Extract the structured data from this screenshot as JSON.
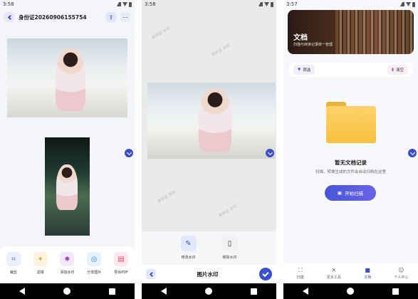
{
  "screen1": {
    "status_time": "3:58",
    "title": "身份证20260906155754",
    "tools": [
      {
        "label": "裁剪",
        "icon": "crop-icon",
        "color": "#5a6be0",
        "bg": "#eceffd"
      },
      {
        "label": "滤镜",
        "icon": "magic-wand-icon",
        "color": "#e7a52c",
        "bg": "#fdf3e1"
      },
      {
        "label": "添加水印",
        "icon": "watermark-icon",
        "color": "#9c47d8",
        "bg": "#f4e9fc"
      },
      {
        "label": "分享图片",
        "icon": "share-icon",
        "color": "#2f8fe0",
        "bg": "#e6f2fd"
      },
      {
        "label": "导出PDF",
        "icon": "pdf-icon",
        "color": "#e34b6a",
        "bg": "#fde8ee"
      }
    ]
  },
  "screen2": {
    "status_time": "3:58",
    "title": "图片水印",
    "tools": [
      {
        "label": "修改水印",
        "icon": "pen-icon"
      },
      {
        "label": "移除水印",
        "icon": "trash-icon"
      }
    ]
  },
  "screen3": {
    "status_time": "3:57",
    "banner_title": "文档",
    "banner_subtitle": "扫描与转换记录统一管理",
    "filter_label": "筛选",
    "clear_label": "清空",
    "empty_title": "暂无文档记录",
    "empty_subtitle": "扫描、转换生成的文件会自动归档在这里",
    "scan_button": "开始扫描",
    "tabs": [
      {
        "label": "扫描",
        "icon": "scan-icon",
        "active": false
      },
      {
        "label": "更多工具",
        "icon": "tools-icon",
        "active": false
      },
      {
        "label": "文档",
        "icon": "folder-icon",
        "active": true
      },
      {
        "label": "个人中心",
        "icon": "user-icon",
        "active": false
      }
    ]
  }
}
